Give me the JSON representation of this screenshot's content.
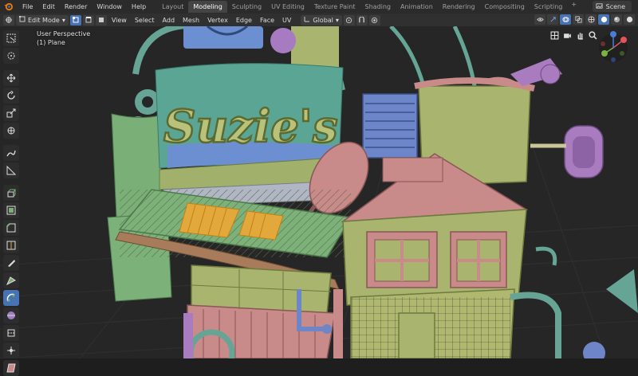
{
  "topbar": {
    "menus": [
      "File",
      "Edit",
      "Render",
      "Window",
      "Help"
    ],
    "tabs": [
      "Layout",
      "Modeling",
      "Sculpting",
      "UV Editing",
      "Texture Paint",
      "Shading",
      "Animation",
      "Rendering",
      "Compositing",
      "Scripting"
    ],
    "active_tab": "Modeling",
    "add_tab": "+",
    "scene_label": "Scene"
  },
  "header": {
    "mode": "Edit Mode",
    "menus": [
      "View",
      "Select",
      "Add",
      "Mesh",
      "Vertex",
      "Edge",
      "Face",
      "UV"
    ],
    "transform_orientation": "Global"
  },
  "viewport": {
    "perspective": "User Perspective",
    "object": "(1) Plane",
    "sign_text": "Suzie's"
  },
  "colors": {
    "accent": "#4772b3",
    "background": "#1e1e1e",
    "teal": "#5fa59a",
    "mauve": "#c98a8a",
    "olive": "#a9b46f",
    "purple": "#a97cc0",
    "blue": "#6e86c8",
    "selected": "#e3a83b"
  }
}
